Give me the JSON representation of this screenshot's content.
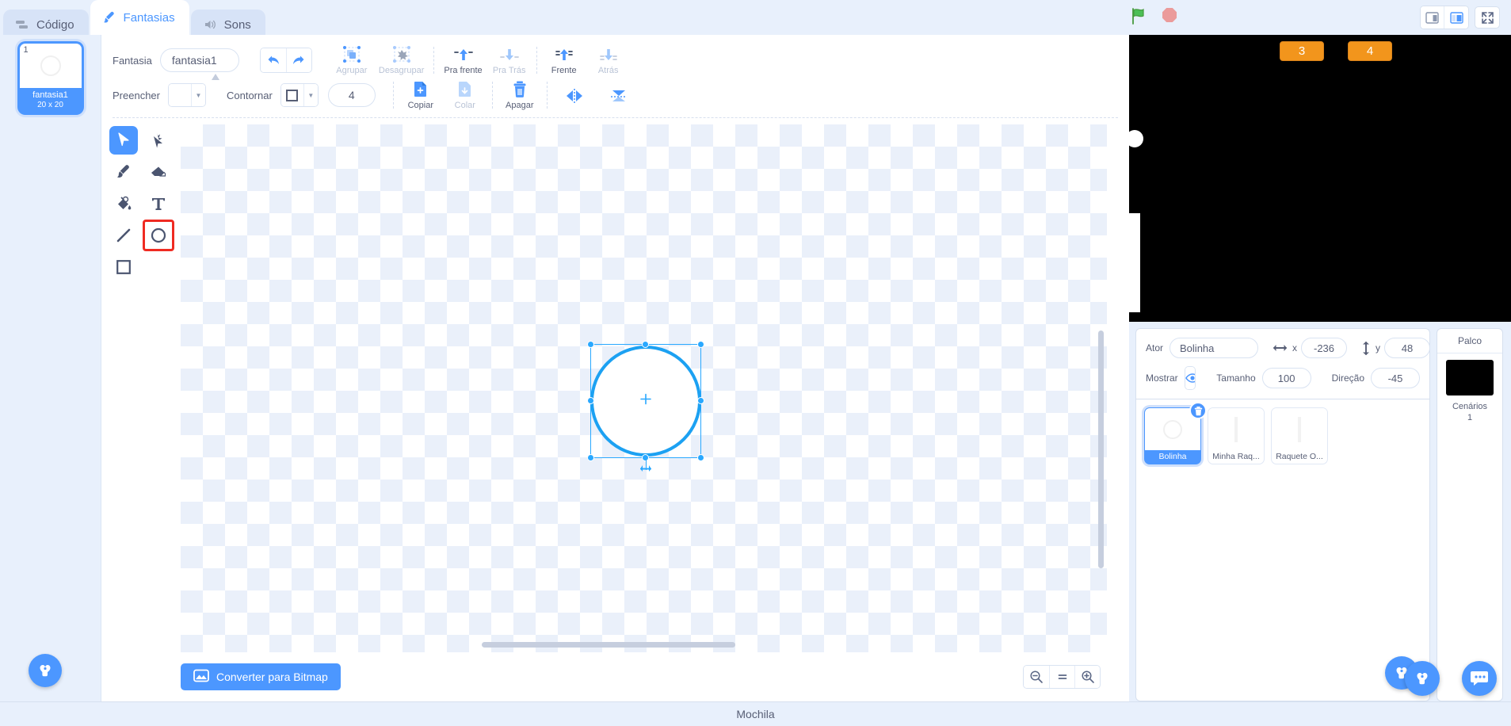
{
  "tabs": [
    {
      "label": "Código",
      "icon": "code-icon",
      "active": false
    },
    {
      "label": "Fantasias",
      "icon": "paintbrush-icon",
      "active": true
    },
    {
      "label": "Sons",
      "icon": "speaker-icon",
      "active": false
    }
  ],
  "stage_controls": {
    "green_flag": "green-flag-icon",
    "stop": "stop-sign-icon",
    "small_stage": "small-stage-icon",
    "large_stage": "large-stage-icon",
    "fullscreen": "fullscreen-icon"
  },
  "costumes": {
    "items": [
      {
        "number": "1",
        "name": "fantasia1",
        "size": "20 x 20",
        "selected": true
      }
    ],
    "add_button": "add-costume-icon"
  },
  "paint_toolbar": {
    "name_label": "Fantasia",
    "name_value": "fantasia1",
    "name_placeholder": "fantasia1",
    "undo": "undo-icon",
    "redo": "redo-icon",
    "group": "Agrupar",
    "ungroup": "Desagrupar",
    "forward": "Pra frente",
    "backward": "Pra Trás",
    "front": "Frente",
    "back": "Atrás",
    "fill_label": "Preencher",
    "outline_label": "Contornar",
    "stroke_width": "4",
    "copy": "Copiar",
    "paste": "Colar",
    "delete": "Apagar",
    "flip_horizontal": "flip-horizontal-icon",
    "flip_vertical": "flip-vertical-icon"
  },
  "tools": [
    {
      "name": "select-tool",
      "icon": "arrow-cursor-icon",
      "active": true,
      "highlighted": false
    },
    {
      "name": "reshape-tool",
      "icon": "reshape-icon",
      "active": false,
      "highlighted": false
    },
    {
      "name": "brush-tool",
      "icon": "paintbrush-icon",
      "active": false,
      "highlighted": false
    },
    {
      "name": "eraser-tool",
      "icon": "eraser-icon",
      "active": false,
      "highlighted": false
    },
    {
      "name": "fill-tool",
      "icon": "paint-bucket-icon",
      "active": false,
      "highlighted": false
    },
    {
      "name": "text-tool",
      "icon": "text-t-icon",
      "active": false,
      "highlighted": false
    },
    {
      "name": "line-tool",
      "icon": "line-icon",
      "active": false,
      "highlighted": false
    },
    {
      "name": "circle-tool",
      "icon": "circle-icon",
      "active": false,
      "highlighted": true
    },
    {
      "name": "rectangle-tool",
      "icon": "square-icon",
      "active": false,
      "highlighted": false
    }
  ],
  "canvas": {
    "convert_button": "Converter para Bitmap",
    "convert_icon": "image-icon",
    "zoom_out": "zoom-out-icon",
    "zoom_reset": "=",
    "zoom_in": "zoom-in-icon"
  },
  "stage": {
    "background_color": "#000000",
    "scores": [
      {
        "value": "3",
        "color": "#f2951c"
      },
      {
        "value": "4",
        "color": "#f2951c"
      }
    ]
  },
  "sprite_info": {
    "actor_label": "Ator",
    "actor_name": "Bolinha",
    "x_label": "x",
    "x_value": "-236",
    "y_label": "y",
    "y_value": "48",
    "show_label": "Mostrar",
    "show_icon": "eye-icon",
    "hide_icon": "eye-crossed-icon",
    "size_label": "Tamanho",
    "size_value": "100",
    "direction_label": "Direção",
    "direction_value": "-45"
  },
  "sprites": [
    {
      "name": "Bolinha",
      "selected": true,
      "thumb": "circle"
    },
    {
      "name": "Minha Raq...",
      "selected": false,
      "thumb": "bar"
    },
    {
      "name": "Raquete O...",
      "selected": false,
      "thumb": "bar"
    }
  ],
  "stage_selector": {
    "title": "Palco",
    "backdrops_label": "Cenários",
    "backdrops_count": "1"
  },
  "bottom": {
    "backpack_label": "Mochila"
  },
  "accent_color": "#4c97ff",
  "highlight_color": "#ef2b22"
}
